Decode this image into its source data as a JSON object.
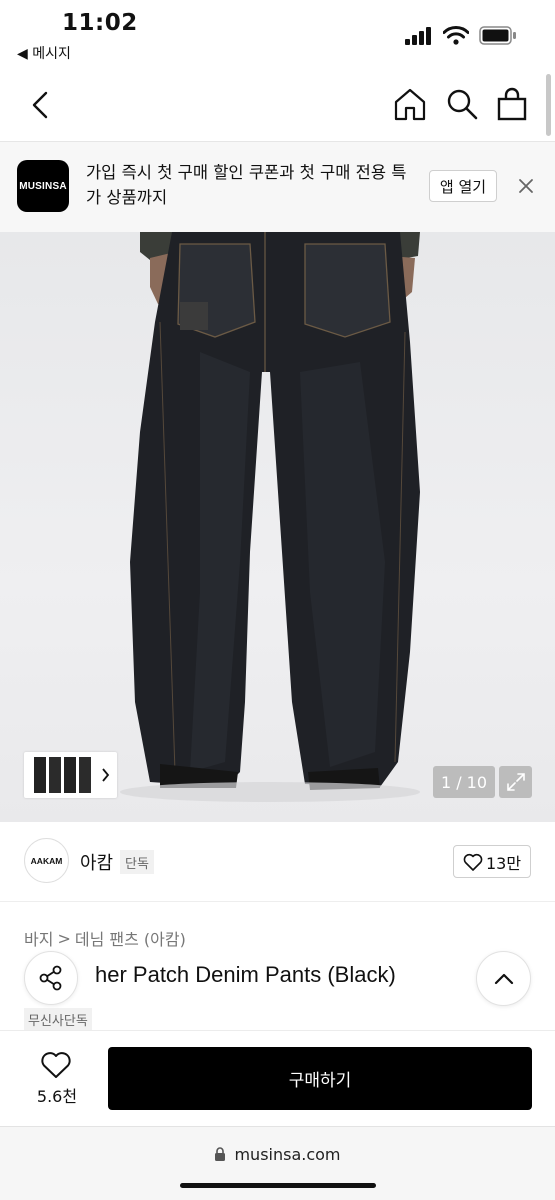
{
  "status_bar": {
    "time": "11:02",
    "back_app_label": "◀ 메시지"
  },
  "banner": {
    "logo_text": "MUSINSA",
    "message": "가입 즉시 첫 구매 할인 쿠폰과 첫 구매 전용 특가 상품까지",
    "open_label": "앱 열기"
  },
  "gallery": {
    "counter": "1 / 10"
  },
  "brand": {
    "logo_text": "AAKAM",
    "name": "아캄",
    "badge": "단독",
    "likes": "13만"
  },
  "breadcrumb": {
    "level1": "바지",
    "separator": ">",
    "level2": "데님 팬츠 (아캄)"
  },
  "product": {
    "title": "her Patch Denim Pants (Black)",
    "exclusive_badge": "무신사단독"
  },
  "purchase_bar": {
    "wish_count": "5.6천",
    "buy_label": "구매하기"
  },
  "browser": {
    "url": "musinsa.com"
  },
  "colors": {
    "accent": "#000000",
    "banner_bg": "#f7f7f7",
    "badge_bg": "#f1f1f1",
    "muted_text": "#777777"
  },
  "icons": [
    "back-chevron-icon",
    "home-icon",
    "search-icon",
    "shopping-bag-icon",
    "close-icon",
    "expand-icon",
    "heart-icon",
    "share-icon",
    "chevron-up-icon",
    "lock-icon",
    "signal-icon",
    "wifi-icon",
    "battery-icon"
  ]
}
